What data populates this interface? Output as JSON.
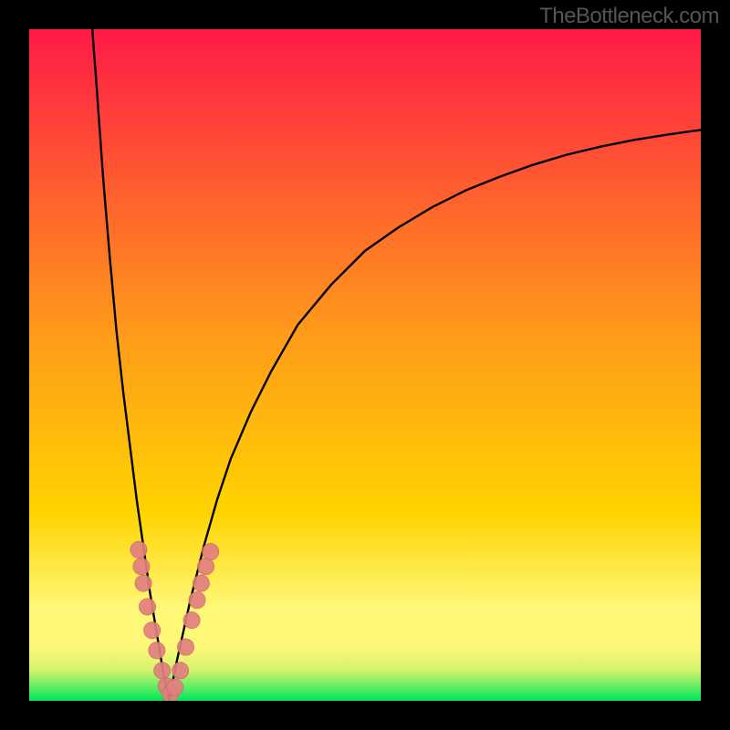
{
  "watermark": "TheBottleneck.com",
  "colors": {
    "frame": "#000000",
    "grad_top": "#ff1a47",
    "grad_mid": "#ffd400",
    "grad_yellow_band": "#fff777",
    "grad_green": "#00e75a",
    "curve": "#000000",
    "dot_fill": "#e18080",
    "dot_stroke": "#d46e6e"
  },
  "chart_data": {
    "type": "line",
    "title": "",
    "xlabel": "",
    "ylabel": "",
    "xlim": [
      0,
      100
    ],
    "ylim": [
      0,
      100
    ],
    "notes": "Two black curves forming a V/cusp near x≈20, minimum y≈0. Left branch rises steeply toward top-left corner; right branch rises and asymptotes toward ~y≈85 at the right edge. A cluster of salmon dots lies along both curves near the valley between roughly y∈[0,22].",
    "series": [
      {
        "name": "left-branch",
        "x": [
          9.4,
          10,
          11,
          12,
          13,
          14,
          15,
          16,
          17,
          18,
          19,
          20,
          20.8
        ],
        "y": [
          100,
          92,
          78,
          66,
          55,
          46,
          38,
          30,
          23,
          16,
          10,
          4,
          0
        ]
      },
      {
        "name": "right-branch",
        "x": [
          20.8,
          22,
          24,
          26,
          28,
          30,
          33,
          36,
          40,
          45,
          50,
          55,
          60,
          65,
          70,
          75,
          80,
          85,
          90,
          95,
          100
        ],
        "y": [
          0,
          6,
          15,
          23,
          30,
          36,
          43,
          49,
          56,
          62,
          67,
          70.5,
          73.5,
          76,
          78,
          79.8,
          81.3,
          82.5,
          83.5,
          84.3,
          85
        ]
      }
    ],
    "dots": [
      {
        "x": 16.3,
        "y": 22.5
      },
      {
        "x": 16.7,
        "y": 20.0
      },
      {
        "x": 17.0,
        "y": 17.5
      },
      {
        "x": 17.6,
        "y": 14.0
      },
      {
        "x": 18.3,
        "y": 10.5
      },
      {
        "x": 19.0,
        "y": 7.5
      },
      {
        "x": 19.8,
        "y": 4.5
      },
      {
        "x": 20.4,
        "y": 2.2
      },
      {
        "x": 21.0,
        "y": 1.0
      },
      {
        "x": 21.7,
        "y": 2.0
      },
      {
        "x": 22.5,
        "y": 4.5
      },
      {
        "x": 23.3,
        "y": 8.0
      },
      {
        "x": 24.2,
        "y": 12.0
      },
      {
        "x": 25.0,
        "y": 15.0
      },
      {
        "x": 25.6,
        "y": 17.5
      },
      {
        "x": 26.3,
        "y": 20.0
      },
      {
        "x": 27.0,
        "y": 22.2
      }
    ]
  }
}
